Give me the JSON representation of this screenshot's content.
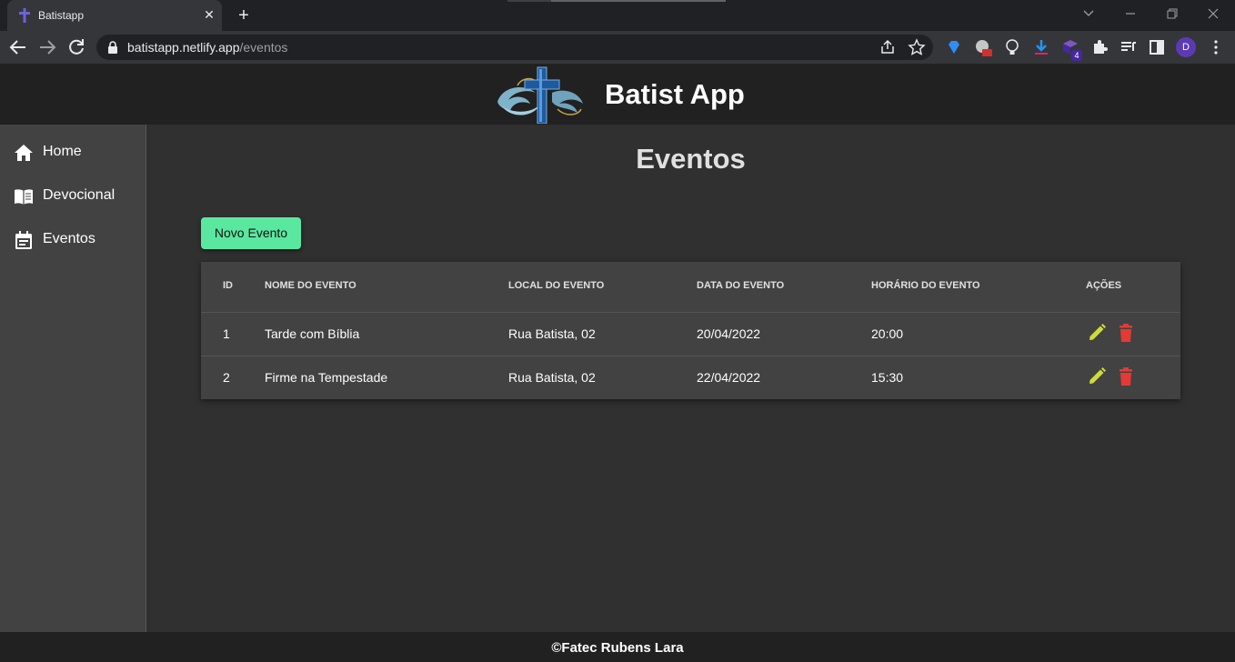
{
  "browser": {
    "tab_title": "Batistapp",
    "tab_close": "✕",
    "new_tab": "+",
    "url_host": "batistapp.netlify.app",
    "url_path": "/eventos",
    "profile_initial": "D",
    "extension_badge": "4"
  },
  "header": {
    "title": "Batist App"
  },
  "sidebar": {
    "items": [
      {
        "label": "Home",
        "icon": "home-icon"
      },
      {
        "label": "Devocional",
        "icon": "book-icon"
      },
      {
        "label": "Eventos",
        "icon": "calendar-icon"
      }
    ]
  },
  "main": {
    "title": "Eventos",
    "new_button": "Novo Evento",
    "table": {
      "headers": [
        "ID",
        "NOME DO EVENTO",
        "LOCAL DO EVENTO",
        "DATA DO EVENTO",
        "HORÁRIO DO EVENTO",
        "AÇÕES"
      ],
      "rows": [
        {
          "id": "1",
          "nome": "Tarde com Bíblia",
          "local": "Rua Batista, 02",
          "data": "20/04/2022",
          "horario": "20:00"
        },
        {
          "id": "2",
          "nome": "Firme na Tempestade",
          "local": "Rua Batista, 02",
          "data": "22/04/2022",
          "horario": "15:30"
        }
      ]
    }
  },
  "footer": {
    "text": "©Fatec Rubens Lara"
  },
  "colors": {
    "accent_button": "#5ae8a0",
    "edit_icon": "#cddc39",
    "delete_icon": "#e53935"
  }
}
